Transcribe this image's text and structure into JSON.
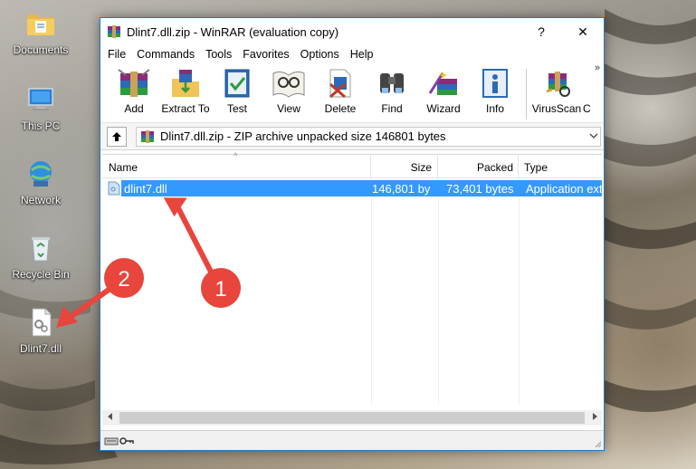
{
  "desktop": {
    "icons": [
      {
        "label": "Documents",
        "icon": "folder-icon"
      },
      {
        "label": "This PC",
        "icon": "computer-icon"
      },
      {
        "label": "Network",
        "icon": "network-icon"
      },
      {
        "label": "Recycle Bin",
        "icon": "recycle-bin-icon"
      },
      {
        "label": "Dlint7.dll",
        "icon": "dll-file-icon"
      }
    ]
  },
  "window": {
    "title": "Dlint7.dll.zip - WinRAR (evaluation copy)",
    "help_btn": "?",
    "close_btn": "✕",
    "menu": [
      "File",
      "Commands",
      "Tools",
      "Favorites",
      "Options",
      "Help"
    ],
    "toolbar": [
      {
        "label": "Add",
        "icon": "add-archive-icon"
      },
      {
        "label": "Extract To",
        "icon": "extract-to-icon"
      },
      {
        "label": "Test",
        "icon": "test-icon"
      },
      {
        "label": "View",
        "icon": "view-icon"
      },
      {
        "label": "Delete",
        "icon": "delete-icon"
      },
      {
        "label": "Find",
        "icon": "find-icon"
      },
      {
        "label": "Wizard",
        "icon": "wizard-icon"
      },
      {
        "label": "Info",
        "icon": "info-icon"
      },
      {
        "label": "VirusScan",
        "icon": "virusscan-icon"
      },
      {
        "label": "C",
        "icon": ""
      }
    ],
    "more": "»",
    "address": "Dlint7.dll.zip - ZIP archive unpacked size 146801 bytes",
    "columns": {
      "name": "Name",
      "size": "Size",
      "packed": "Packed",
      "type": "Type"
    },
    "files": [
      {
        "name": "dlint7.dll",
        "size": "146,801 by",
        "packed": "73,401 bytes",
        "type": "Application ext"
      }
    ]
  },
  "annotations": {
    "marker1": "1",
    "marker2": "2",
    "color": "#e8453c"
  }
}
